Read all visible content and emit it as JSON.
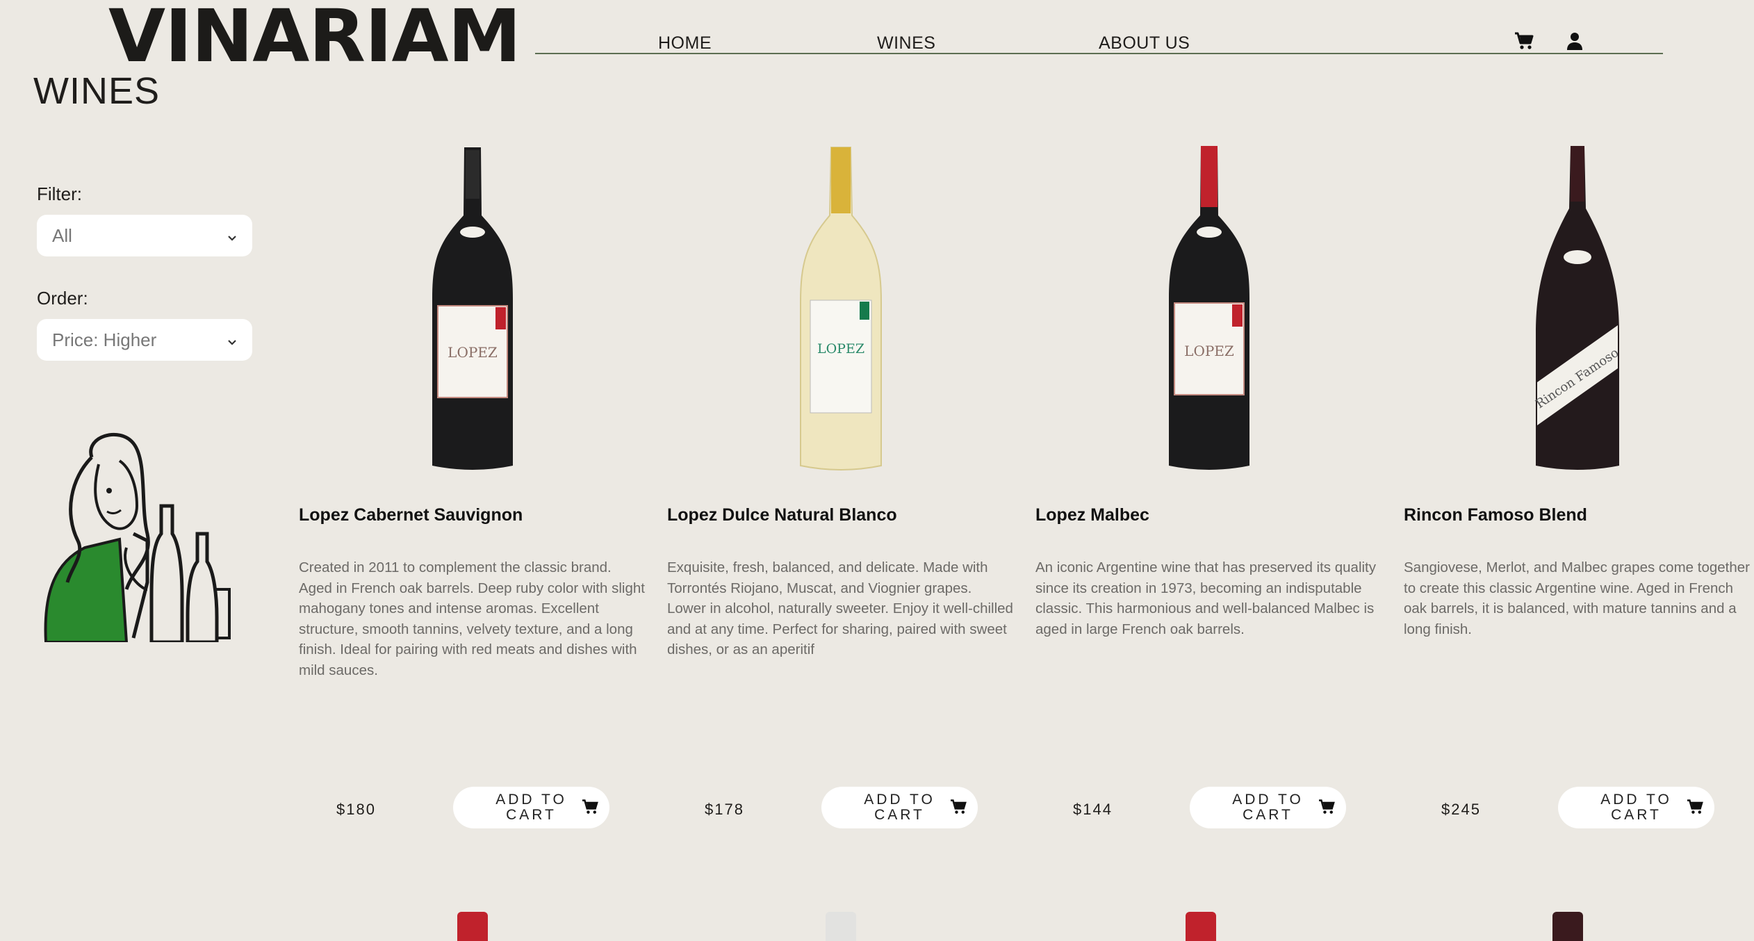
{
  "brand": {
    "logo": "VINARIAM"
  },
  "nav": {
    "items": [
      "HOME",
      "WINES",
      "ABOUT US"
    ],
    "cart_icon": "cart-icon",
    "user_icon": "user-icon",
    "accent": "#5c6e52"
  },
  "page": {
    "title": "WINES"
  },
  "filters": {
    "filter_label": "Filter:",
    "filter_value": "All",
    "order_label": "Order:",
    "order_value": "Price: Higher"
  },
  "wines": [
    {
      "name": "Lopez Cabernet Sauvignon",
      "description": "Created in 2011 to complement the classic brand. Aged in French oak barrels. Deep ruby color with slight mahogany tones and intense aromas. Excellent structure, smooth tannins, velvety texture, and a long finish. Ideal for pairing with red meats and dishes with mild sauces.",
      "price": "$180",
      "button": "ADD TO CART"
    },
    {
      "name": "Lopez Dulce Natural Blanco",
      "description": "Exquisite, fresh, balanced, and delicate. Made with Torrontés Riojano, Muscat, and Viognier grapes. Lower in alcohol, naturally sweeter. Enjoy it well-chilled and at any time. Perfect for sharing, paired with sweet dishes, or as an aperitif",
      "price": "$178",
      "button": "ADD TO CART"
    },
    {
      "name": "Lopez Malbec",
      "description": "An iconic Argentine wine that has preserved its quality since its creation in 1973, becoming an indisputable classic. This harmonious and well-balanced Malbec is aged in large French oak barrels.",
      "price": "$144",
      "button": "ADD TO CART"
    },
    {
      "name": "Rincon Famoso Blend",
      "description": "Sangiovese, Merlot, and Malbec grapes come together to create this classic Argentine wine. Aged in French oak barrels, it is balanced, with mature tannins and a long finish.",
      "price": "$245",
      "button": "ADD TO CART"
    }
  ],
  "colors": {
    "background": "#ece9e3",
    "illustration_green": "#2a8a2e"
  }
}
